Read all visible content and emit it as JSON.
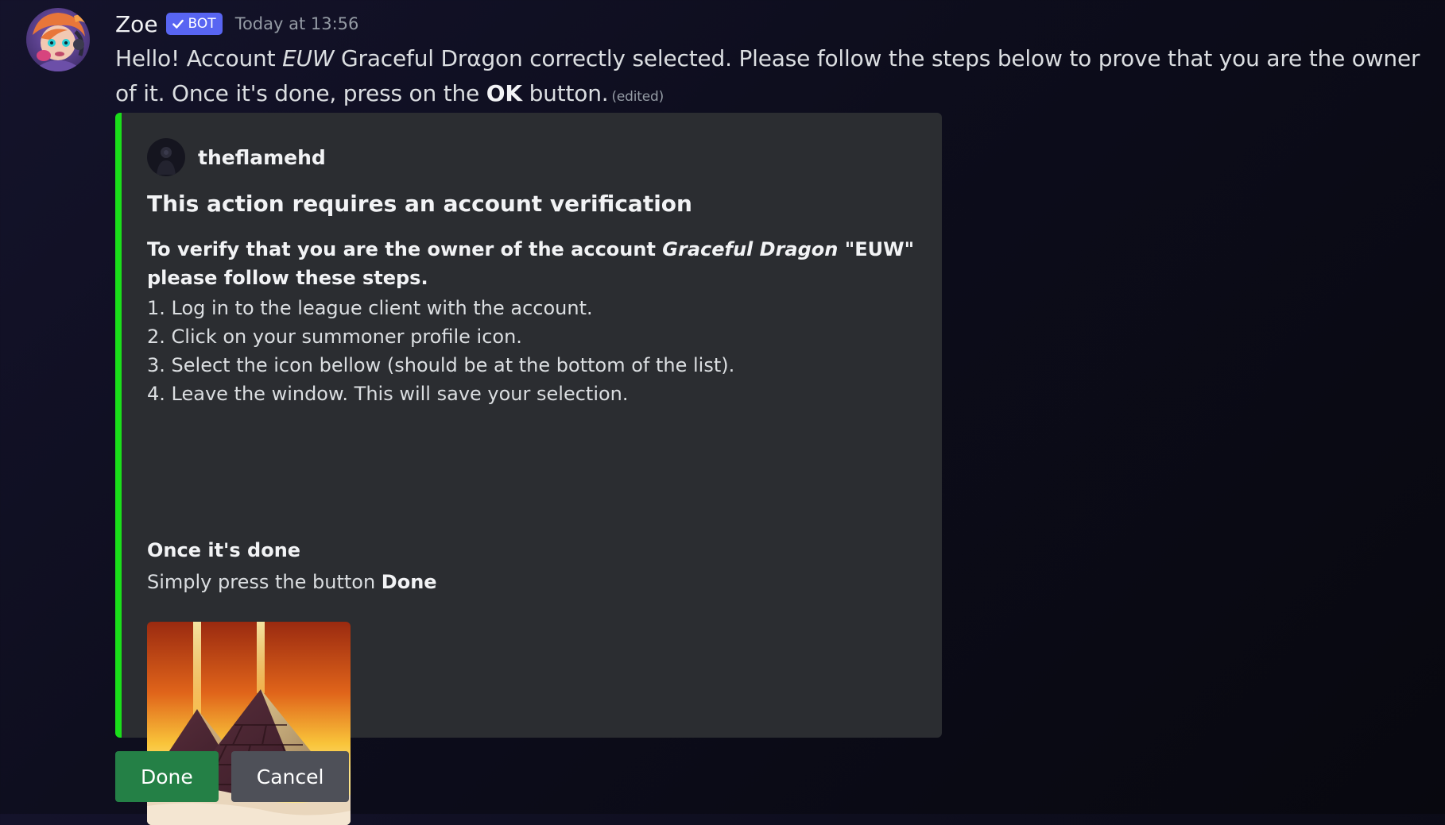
{
  "author": {
    "name": "Zoe",
    "bot_tag": "BOT",
    "timestamp": "Today at 13:56",
    "avatar_icon": "zoe-avatar"
  },
  "message": {
    "part1": "Hello! Account ",
    "region": "EUW",
    "part2": " Graceful Drαgon correctly selected. Please follow the steps below to prove that you are the owner of it. Once it's done, press on the ",
    "ok_word": "OK",
    "part3": " button.",
    "edited": "(edited)"
  },
  "embed": {
    "accent_color": "#1ade1a",
    "author_name": "theflamehd",
    "title": "This action requires an account verification",
    "lead_part1": "To verify that you are the owner of the account ",
    "lead_account": "Graceful Dragon",
    "lead_part2": " \"EUW\" please follow these steps.",
    "steps": [
      "1. Log in to the league client with the account.",
      "2. Click on your summoner profile icon.",
      "3. Select the icon bellow (should be at the bottom of the list).",
      "4. Leave the window. This will save your selection."
    ],
    "field_name": "Once it's done",
    "field_value_prefix": "Simply press the button ",
    "field_value_bold": "Done",
    "image_icon": "pyramids-summoner-icon"
  },
  "buttons": {
    "done_label": "Done",
    "done_color": "#248046",
    "cancel_label": "Cancel",
    "cancel_color": "#4e5058"
  }
}
